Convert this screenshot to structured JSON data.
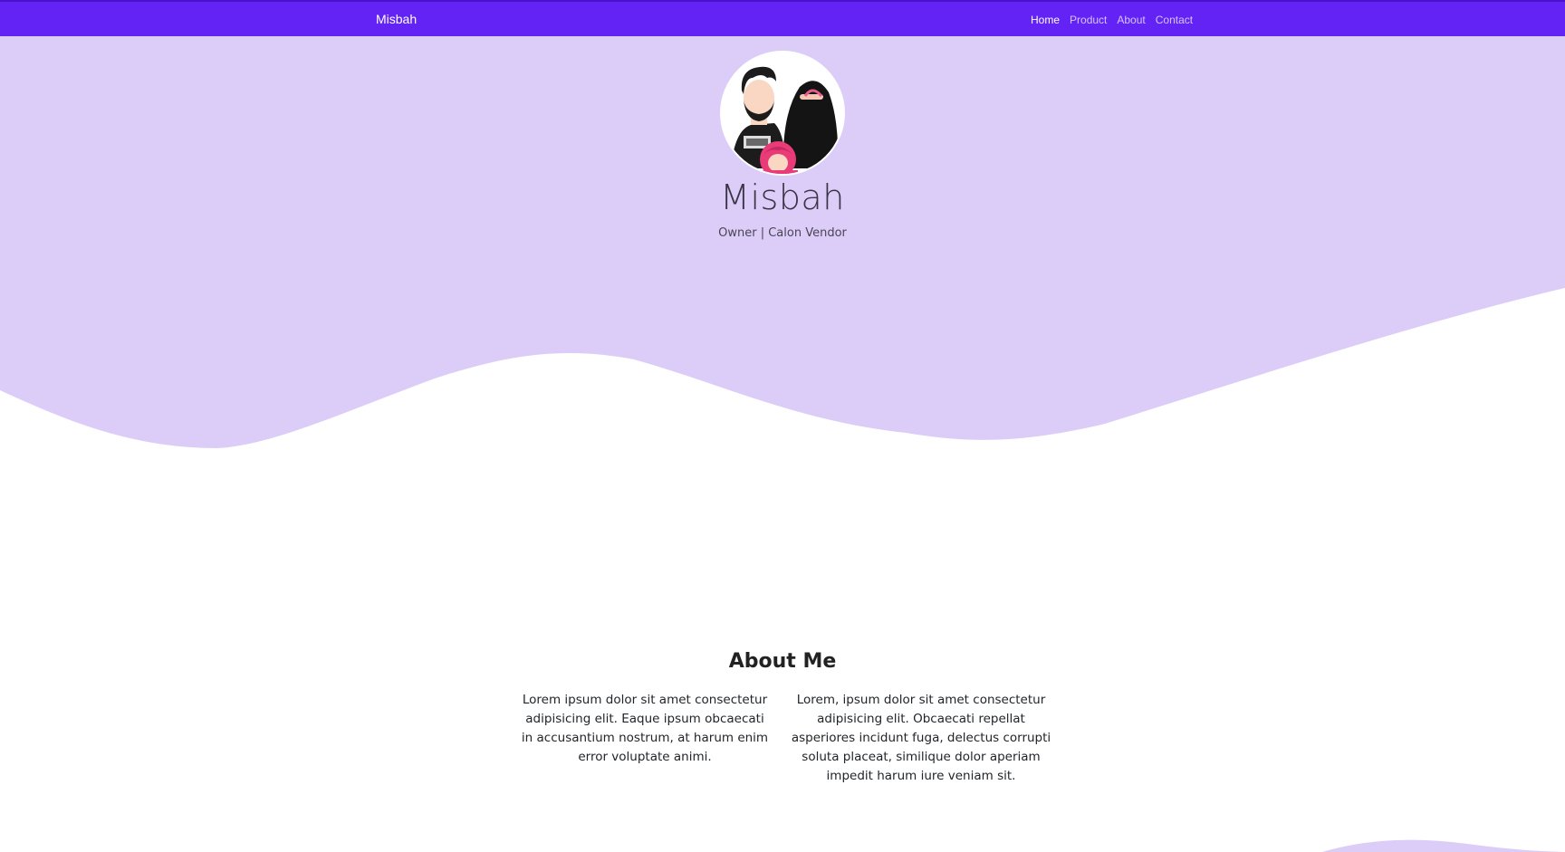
{
  "navbar": {
    "brand": "Misbah",
    "links": [
      {
        "label": "Home",
        "active": true
      },
      {
        "label": "Product",
        "active": false
      },
      {
        "label": "About",
        "active": false
      },
      {
        "label": "Contact",
        "active": false
      }
    ]
  },
  "hero": {
    "name": "Misbah",
    "subtitle": "Owner | Calon Vendor",
    "avatar_icon": "family-avatar-icon"
  },
  "about": {
    "title": "About Me",
    "paragraphs": [
      "Lorem ipsum dolor sit amet consectetur adipisicing elit. Eaque ipsum obcaecati in accusantium nostrum, at harum enim error voluptate animi.",
      "Lorem, ipsum dolor sit amet consectetur adipisicing elit. Obcaecati repellat asperiores incidunt fuga, delectus corrupti soluta placeat, similique dolor aperiam impedit harum iure veniam sit."
    ]
  },
  "colors": {
    "navbar": "#6423f5",
    "hero_bg": "#dccdf8",
    "text_dark": "#212529"
  }
}
